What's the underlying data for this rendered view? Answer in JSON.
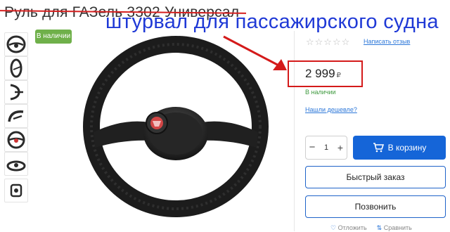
{
  "product": {
    "title": "Руль для ГАЗель 3302 Универсал",
    "overlay_caption": "штурвал для пассажирского судна",
    "stock_badge": "В наличии"
  },
  "rating": {
    "stars": "☆☆☆☆☆",
    "write_review": "Написать отзыв"
  },
  "price": {
    "value": "2 999",
    "currency": "₽",
    "stock": "В наличии",
    "cheaper_link": "Нашли дешевле?"
  },
  "quantity": {
    "minus": "−",
    "value": "1",
    "plus": "+"
  },
  "buttons": {
    "cart": "В корзину",
    "quick_order": "Быстрый заказ",
    "call": "Позвонить"
  },
  "bottom_links": {
    "favorite": "Отложить",
    "compare": "Сравнить"
  },
  "icons": {
    "cart": "cart-icon",
    "heart": "heart-icon",
    "compare": "compare-icon",
    "arrow": "arrow-icon"
  },
  "colors": {
    "accent_blue": "#1565d8",
    "caption_blue": "#1f39d6",
    "alert_red": "#d41a1a",
    "stock_green": "#6fb04a"
  }
}
